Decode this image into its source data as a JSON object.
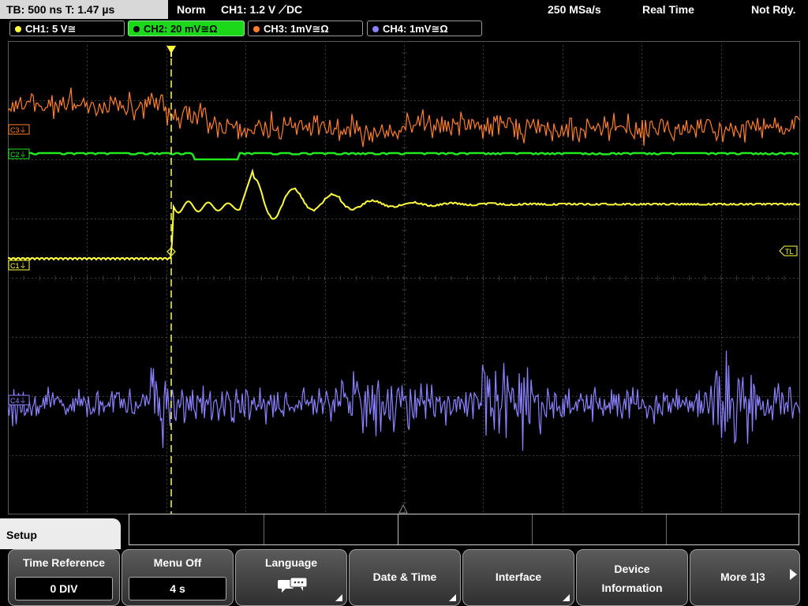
{
  "topbar": {
    "timebase": "TB: 500 ns   T: 1.47 µs",
    "mode": "Norm",
    "trigger": "CH1: 1.2 V ⟋DC",
    "sample_rate": "250 MSa/s",
    "acq_mode": "Real Time",
    "status": "Not Rdy."
  },
  "channels": [
    {
      "label": "CH1: 5 V≅",
      "color": "#ffff3c"
    },
    {
      "label": "CH2: 20 mV≅Ω",
      "color": "#1bd81b"
    },
    {
      "label": "CH3: 1mV≅Ω",
      "color": "#ff7f27"
    },
    {
      "label": "CH4: 1mV≅Ω",
      "color": "#8c82ff"
    }
  ],
  "markers": {
    "c3": "C3⏚",
    "c2": "C2⏚",
    "c1": "C1⏚",
    "c4": "C4⏚",
    "trigger_level": "TL"
  },
  "colors": {
    "ch1": "#ffff3c",
    "ch2": "#22e822",
    "ch3": "#ff7f27",
    "ch4": "#8c82ff",
    "grid": "#3c3c3c"
  },
  "menu": {
    "title": "Setup",
    "softkeys": [
      {
        "label": "Time Reference",
        "value": "0 DIV"
      },
      {
        "label": "Menu Off",
        "value": "4 s"
      },
      {
        "label": "Language",
        "icon": "speech-bubbles-icon"
      },
      {
        "label": "Date & Time"
      },
      {
        "label": "Interface"
      },
      {
        "label": "Device",
        "label2": "Information"
      },
      {
        "label": "More 1|3"
      }
    ]
  }
}
